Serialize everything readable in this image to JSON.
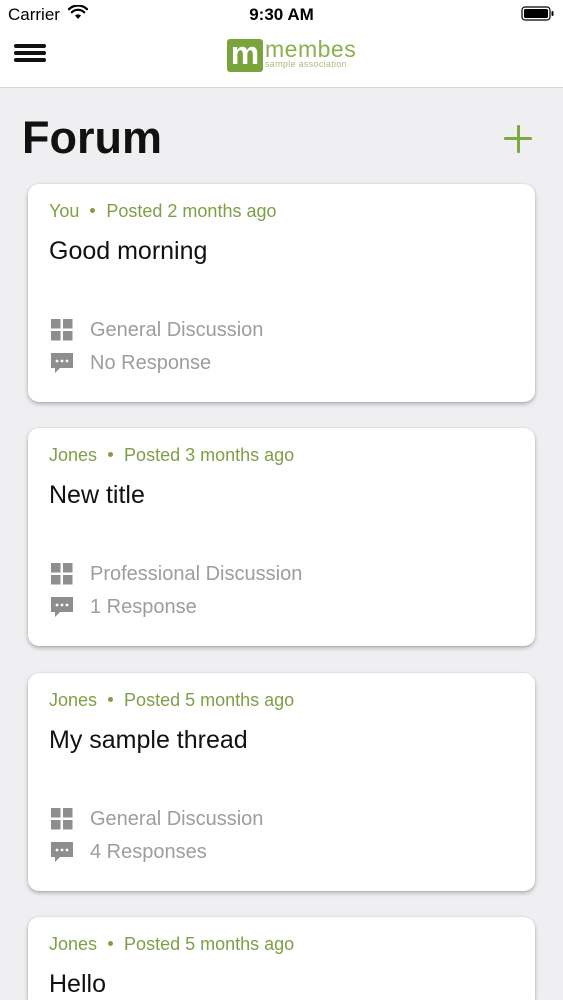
{
  "status_bar": {
    "carrier": "Carrier",
    "time": "9:30 AM",
    "wifi_icon": "wifi-icon",
    "battery_icon": "battery-icon"
  },
  "nav_bar": {
    "menu_icon": "hamburger-menu-icon",
    "logo": {
      "mark": "m",
      "name": "membes",
      "tagline": "sample association",
      "color": "#7aa43b"
    }
  },
  "page": {
    "title": "Forum",
    "add_icon": "plus-icon",
    "accent_color": "#7ea843"
  },
  "posts": [
    {
      "author": "You",
      "posted": "Posted 2 months ago",
      "title": "Good morning",
      "category": "General Discussion",
      "responses": "No Response"
    },
    {
      "author": "Jones",
      "posted": "Posted 3 months ago",
      "title": "New title",
      "category": "Professional Discussion",
      "responses": "1 Response"
    },
    {
      "author": "Jones",
      "posted": "Posted 5 months ago",
      "title": "My sample thread",
      "category": "General Discussion",
      "responses": "4 Responses"
    },
    {
      "author": "Jones",
      "posted": "Posted 5 months ago",
      "title": "Hello",
      "category": "",
      "responses": ""
    }
  ]
}
